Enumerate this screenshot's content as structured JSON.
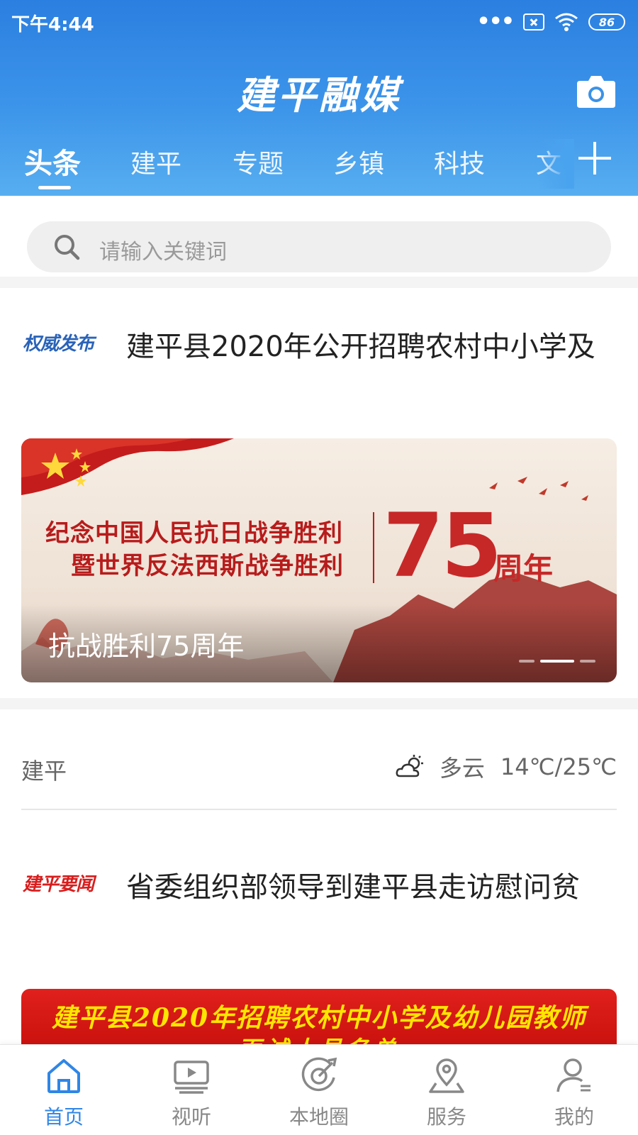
{
  "status_bar": {
    "time": "下午4:44",
    "dots": "•••",
    "battery": "86"
  },
  "header": {
    "app_title": "建平融媒"
  },
  "tabs": [
    {
      "label": "头条"
    },
    {
      "label": "建平"
    },
    {
      "label": "专题"
    },
    {
      "label": "乡镇"
    },
    {
      "label": "科技"
    },
    {
      "label": "文"
    }
  ],
  "search": {
    "placeholder": "请输入关键词"
  },
  "news": [
    {
      "tag": "权威发布",
      "tag_color": "#2a63b8",
      "title": "建平县2020年公开招聘农村中小学及"
    },
    {
      "tag": "建平要闻",
      "tag_color": "#d71e1e",
      "title": "省委组织部领导到建平县走访慰问贫"
    }
  ],
  "banner": {
    "line1": "纪念中国人民抗日战争胜利",
    "line2": "暨世界反法西斯战争胜利",
    "number": "75",
    "unit": "周年",
    "caption": "抗战胜利75周年",
    "pages": 3,
    "current_page": 2
  },
  "weather": {
    "city": "建平",
    "condition": "多云",
    "temp": "14℃/25℃"
  },
  "bottom_banner": {
    "line1": "建平县2020年招聘农村中小学及幼儿园教师",
    "line2": "面试人员名单"
  },
  "bottom_nav": [
    {
      "label": "首页",
      "icon": "home-icon",
      "active": true
    },
    {
      "label": "视听",
      "icon": "video-icon",
      "active": false
    },
    {
      "label": "本地圈",
      "icon": "circle-icon",
      "active": false
    },
    {
      "label": "服务",
      "icon": "location-icon",
      "active": false
    },
    {
      "label": "我的",
      "icon": "user-icon",
      "active": false
    }
  ],
  "colors": {
    "accent": "#2f86e6",
    "header_top": "#2b7fe0",
    "header_bottom": "#57aef0",
    "banner_red": "#c62828"
  }
}
